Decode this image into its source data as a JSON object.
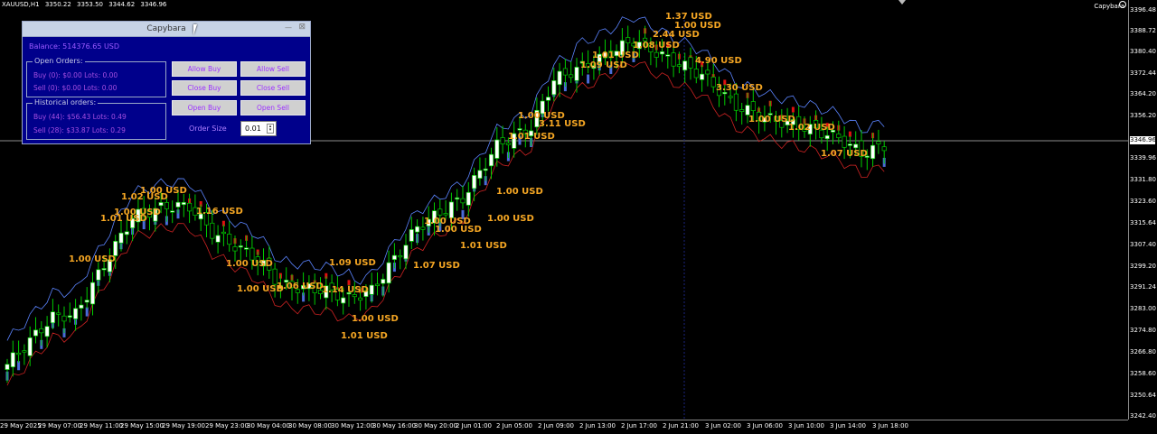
{
  "header": {
    "symbol": "XAUUSD,H1",
    "bid": "3350.22",
    "high": "3353.50",
    "low": "3344.62",
    "close": "3346.96",
    "ea_label": "Capybara"
  },
  "price_axis": {
    "labels": [
      "3396.48",
      "3388.72",
      "3380.40",
      "3372.44",
      "3364.20",
      "3356.20",
      "3339.96",
      "3331.80",
      "3323.60",
      "3315.64",
      "3307.40",
      "3299.20",
      "3291.24",
      "3283.00",
      "3274.80",
      "3266.80",
      "3258.60",
      "3250.64",
      "3242.40"
    ],
    "current_price": "3346.96"
  },
  "time_axis": {
    "labels": [
      "29 May 2025",
      "29 May 07:00",
      "29 May 11:00",
      "29 May 15:00",
      "29 May 19:00",
      "29 May 23:00",
      "30 May 04:00",
      "30 May 08:00",
      "30 May 12:00",
      "30 May 16:00",
      "30 May 20:00",
      "2 Jun 01:00",
      "2 Jun 05:00",
      "2 Jun 09:00",
      "2 Jun 13:00",
      "2 Jun 17:00",
      "2 Jun 21:00",
      "3 Jun 02:00",
      "3 Jun 06:00",
      "3 Jun 10:00",
      "3 Jun 14:00",
      "3 Jun 18:00"
    ]
  },
  "panel": {
    "title": "Capybara",
    "balance": "Balance: 514376.65 USD",
    "open_orders_title": "Open Orders:",
    "open_buy": "Buy (0): $0.00 Lots: 0.00",
    "open_sell": "Sell (0): $0.00 Lots: 0.00",
    "hist_title": "Historical orders:",
    "hist_buy": "Buy (44): $56.43 Lots: 0.49",
    "hist_sell": "Sell (28): $33.87 Lots: 0.29",
    "buttons": {
      "allow_buy": "Allow Buy",
      "allow_sell": "Allow Sell",
      "close_buy": "Close Buy",
      "close_sell": "Close Sell",
      "open_buy": "Open Buy",
      "open_sell": "Open Sell"
    },
    "order_size_label": "Order Size",
    "order_size_value": "0.01"
  },
  "trade_labels": [
    "1.37 USD",
    "1.00 USD",
    "2.44 USD",
    "1.08 USD",
    "1.01 USD",
    "1.09 USD",
    "4.90 USD",
    "3.30 USD",
    "1.00 USD",
    "1.02 USD",
    "1.07 USD",
    "1.00 USD",
    "1.01 USD",
    "3.11 USD",
    "1.00 USD",
    "1.00 USD",
    "1.00 USD",
    "1.01 USD",
    "1.00 USD",
    "1.07 USD",
    "1.00 USD",
    "1.01 USD",
    "1.09 USD",
    "1.14 USD",
    "1.00 USD",
    "1.06 USD",
    "1.00 USD",
    "1.02 USD",
    "1.01 USD",
    "1.16 USD",
    "1.00 USD",
    "1.00 USD",
    "1.00 USD"
  ],
  "colors": {
    "bull": "#ffffff",
    "bear": "#000000",
    "wick": "#00cc00",
    "label": "#f5a623",
    "upper_band": "#5b84ff",
    "lower_band": "#cc2222",
    "trend_up": "#4a6bd8",
    "trend_down": "#e01010"
  }
}
